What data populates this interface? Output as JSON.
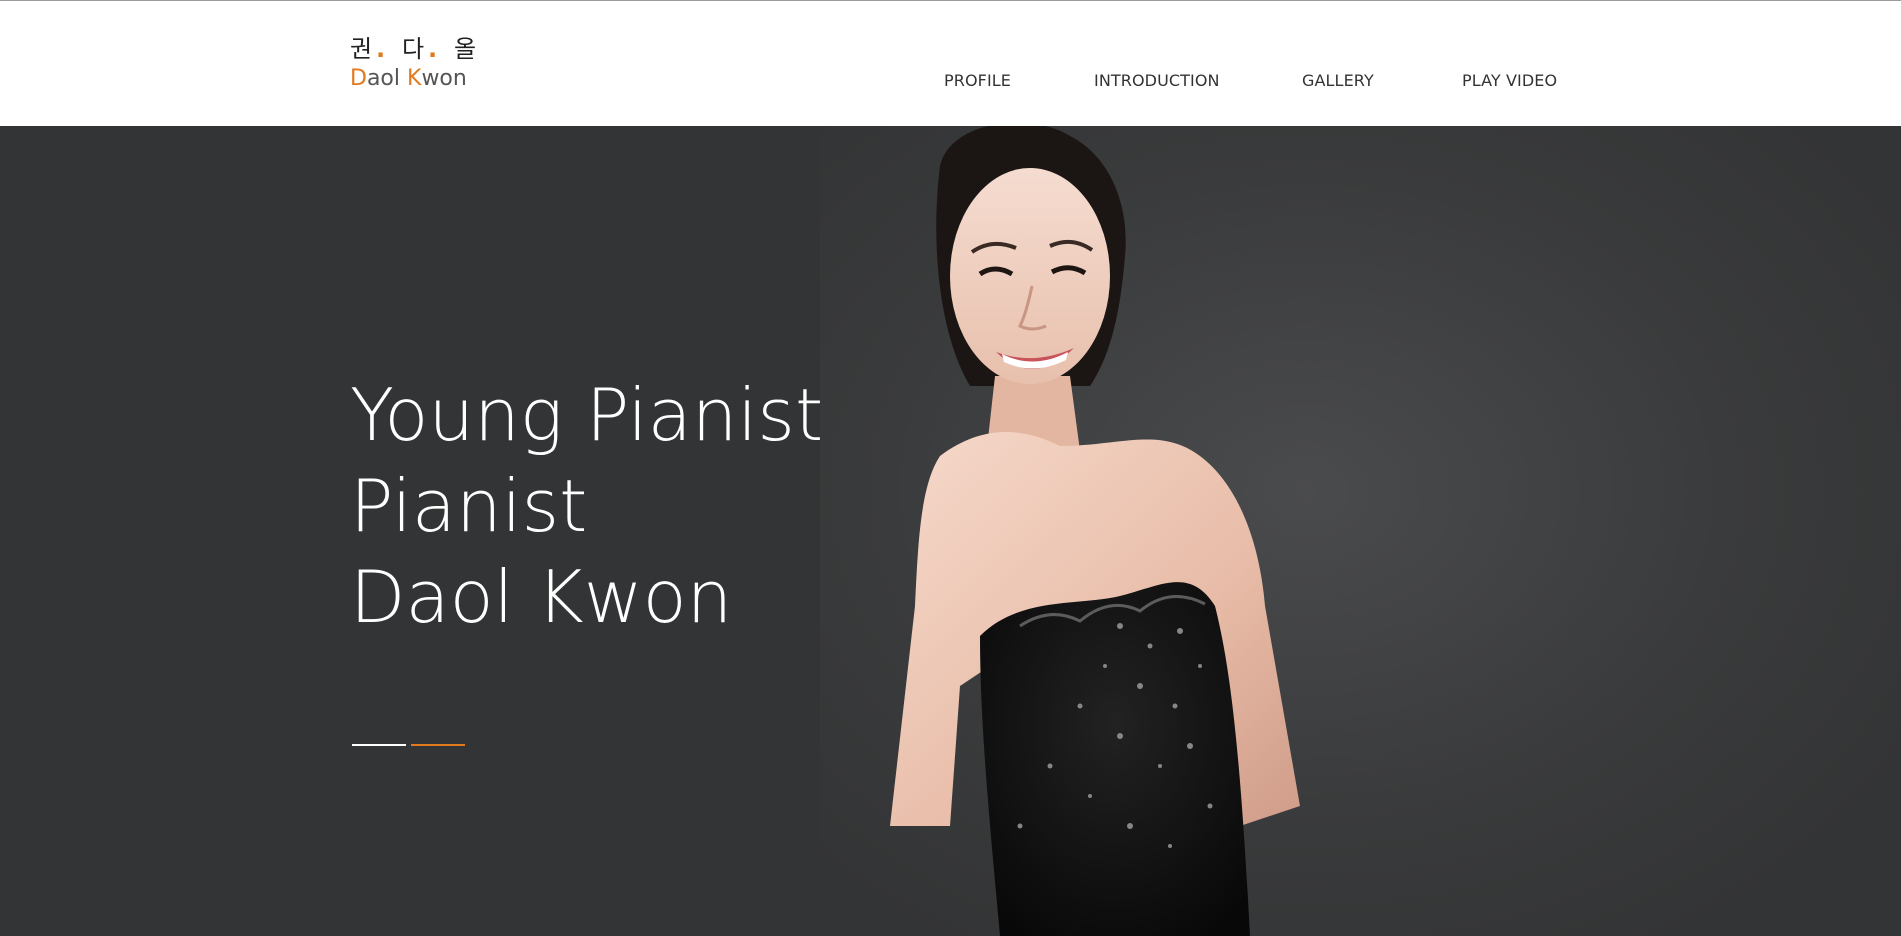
{
  "logo": {
    "korean_1": "권",
    "korean_2": "다",
    "korean_3": "올",
    "dot": ".",
    "latin_initial_1": "D",
    "latin_rest_1": "aol ",
    "latin_initial_2": "K",
    "latin_rest_2": "won",
    "accent_color": "#e07a1f"
  },
  "nav": {
    "items": [
      {
        "label": "PROFILE"
      },
      {
        "label": "INTRODUCTION"
      },
      {
        "label": "GALLERY"
      },
      {
        "label": "PLAY VIDEO"
      }
    ]
  },
  "hero": {
    "line_1": "Young Pianist",
    "line_2": "Pianist",
    "line_3": "Daol Kwon",
    "background_color": "#333435",
    "slides": {
      "count": 2,
      "active_index": 1
    }
  },
  "icons": {
    "photo": "pianist-portrait-photo"
  }
}
